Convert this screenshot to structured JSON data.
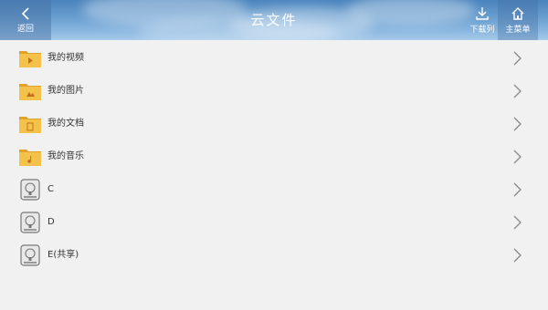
{
  "header": {
    "back_label": "返回",
    "title": "云文件",
    "download_label": "下载列",
    "home_label": "主菜单"
  },
  "items": [
    {
      "label": "我的视频",
      "kind": "folder",
      "badge": "video"
    },
    {
      "label": "我的图片",
      "kind": "folder",
      "badge": "image"
    },
    {
      "label": "我的文档",
      "kind": "folder",
      "badge": "doc"
    },
    {
      "label": "我的音乐",
      "kind": "folder",
      "badge": "music"
    },
    {
      "label": "C",
      "kind": "drive"
    },
    {
      "label": "D",
      "kind": "drive"
    },
    {
      "label": "E(共享)",
      "kind": "drive"
    }
  ],
  "colors": {
    "folder": "#f4c24a",
    "folder_dark": "#e0a22a",
    "chevron": "#888888"
  }
}
